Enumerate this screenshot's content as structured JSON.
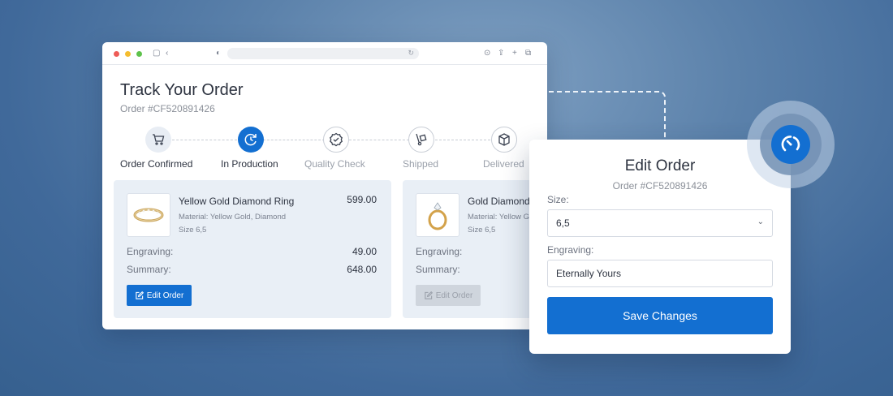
{
  "tracking": {
    "title": "Track Your Order",
    "order_number": "Order #CF520891426",
    "steps": [
      {
        "label": "Order Confirmed",
        "state": "done",
        "icon": "cart-icon"
      },
      {
        "label": "In Production",
        "state": "active",
        "icon": "refresh-clock-icon"
      },
      {
        "label": "Quality Check",
        "state": "todo",
        "icon": "badge-check-icon"
      },
      {
        "label": "Shipped",
        "state": "todo",
        "icon": "hand-truck-icon"
      },
      {
        "label": "Delivered",
        "state": "todo",
        "icon": "box-icon"
      }
    ]
  },
  "items": [
    {
      "name": "Yellow Gold Diamond Ring",
      "price": "599.00",
      "material": "Material: Yellow Gold, Diamond",
      "size": "Size 6,5",
      "engraving_label": "Engraving:",
      "engraving_value": "49.00",
      "summary_label": "Summary:",
      "summary_value": "648.00",
      "edit_label": "Edit Order",
      "icon": "band-ring-icon",
      "enabled": true
    },
    {
      "name": "Gold Diamond Ring",
      "price": "",
      "material": "Material: Yellow Gold",
      "size": "Size 6,5",
      "engraving_label": "Engraving:",
      "engraving_value": "",
      "summary_label": "Summary:",
      "summary_value": "",
      "edit_label": "Edit Order",
      "icon": "solitaire-ring-icon",
      "enabled": false
    }
  ],
  "edit_dialog": {
    "title": "Edit Order",
    "order_number": "Order #CF520891426",
    "size_label": "Size:",
    "size_value": "6,5",
    "engraving_label": "Engraving:",
    "engraving_value": "Eternally Yours",
    "save_label": "Save Changes"
  },
  "colors": {
    "accent": "#136fd1",
    "card_bg": "#e9eff6"
  }
}
